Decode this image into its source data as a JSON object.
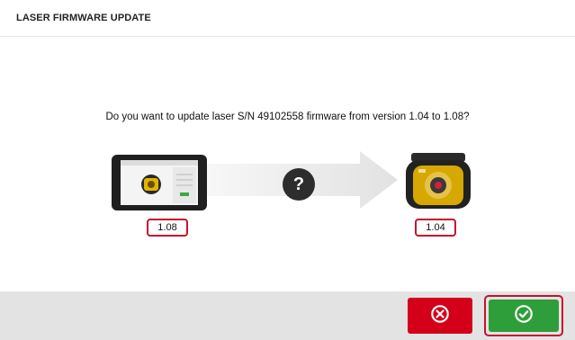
{
  "header": {
    "title": "LASER FIRMWARE UPDATE"
  },
  "dialog": {
    "question": "Do you want to update laser S/N 49102558 firmware from version 1.04 to 1.08?",
    "tablet_version": "1.08",
    "laser_version": "1.04",
    "status_symbol": "?"
  },
  "footer": {
    "cancel_icon": "x-circle-icon",
    "confirm_icon": "check-circle-icon"
  },
  "colors": {
    "cancel": "#d4001a",
    "confirm": "#2e9e3a",
    "highlight_border": "#c8102e"
  }
}
